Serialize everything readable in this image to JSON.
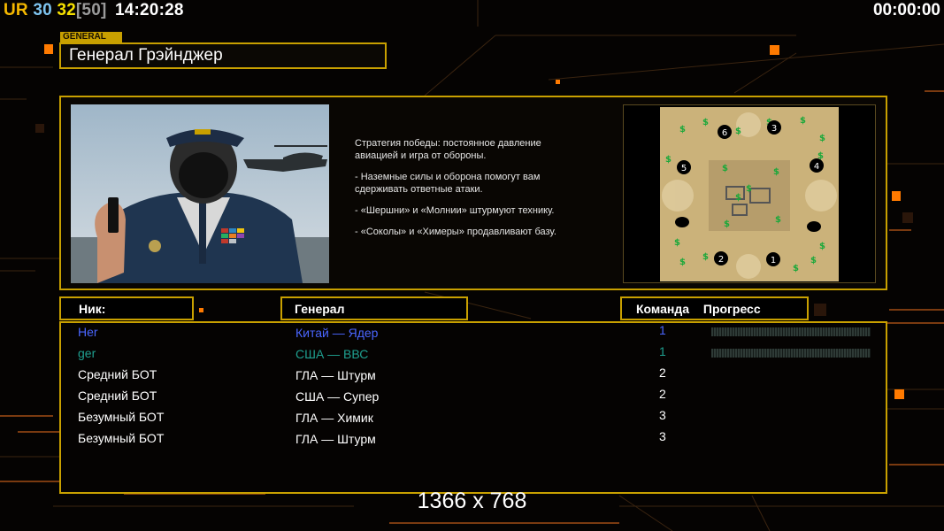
{
  "hud": {
    "ur_label": "UR",
    "fps_a": "30",
    "fps_b": "32",
    "fps_cap": "[50]",
    "clock": "14:20:28",
    "timer": "00:00:00"
  },
  "general": {
    "tag": "GENERAL",
    "name": "Генерал Грэйнджер",
    "description": [
      "Стратегия победы: постоянное давление\n авиацией и игра от обороны.",
      "- Наземные силы и оборона помогут вам\n сдерживать ответные атаки.",
      "- «Шершни» и «Молнии» штурмуют технику.",
      "- «Соколы» и «Химеры» продавливают базу."
    ]
  },
  "map": {
    "start_positions": [
      "1",
      "2",
      "3",
      "4",
      "5",
      "6"
    ]
  },
  "table": {
    "headers": {
      "nick": "Ник:",
      "general": "Генерал",
      "team": "Команда",
      "progress": "Прогресс"
    },
    "players": [
      {
        "nick": "Her",
        "general": "Китай — Ядер",
        "team": "1",
        "color": "#4a66ff",
        "progress_bar": true
      },
      {
        "nick": "ger",
        "general": "США — ВВС",
        "team": "1",
        "color": "#1fa090",
        "progress_bar": true
      },
      {
        "nick": "Средний БОТ",
        "general": "ГЛА — Штурм",
        "team": "2",
        "color": "#ffffff",
        "progress_bar": false
      },
      {
        "nick": "Средний БОТ",
        "general": "США — Супер",
        "team": "2",
        "color": "#ffffff",
        "progress_bar": false
      },
      {
        "nick": "Безумный БОТ",
        "general": "ГЛА — Химик",
        "team": "3",
        "color": "#ffffff",
        "progress_bar": false
      },
      {
        "nick": "Безумный БОТ",
        "general": "ГЛА — Штурм",
        "team": "3",
        "color": "#ffffff",
        "progress_bar": false
      }
    ]
  },
  "footer": {
    "resolution": "1366 x 768"
  },
  "colors": {
    "frame_gold": "#c8a000",
    "accent_orange": "#ff7a00",
    "accent_red": "#d92b00"
  }
}
